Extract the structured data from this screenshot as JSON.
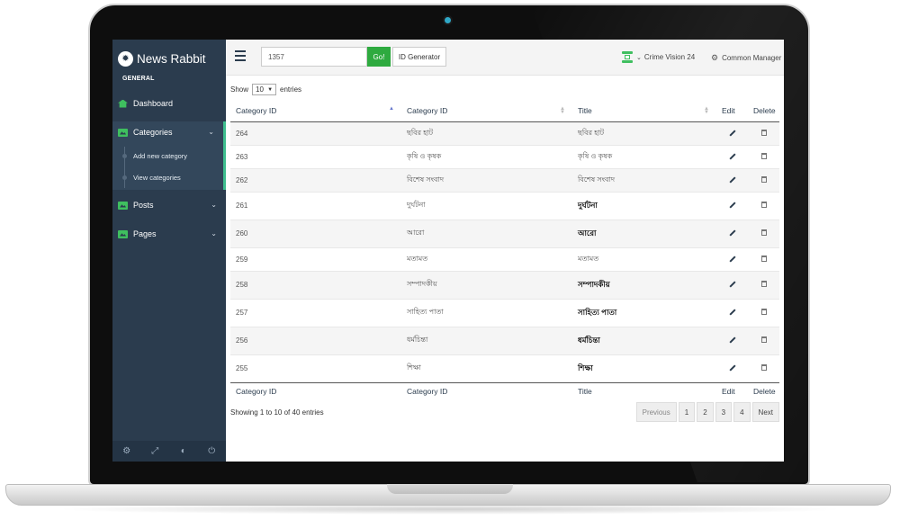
{
  "app": {
    "name": "News Rabbit"
  },
  "sidebar": {
    "section_label": "GENERAL",
    "dashboard": "Dashboard",
    "categories": "Categories",
    "sub_items": [
      "Add new category",
      "View categories"
    ],
    "posts": "Posts",
    "pages": "Pages",
    "footer_icons": [
      "gear-icon",
      "fullscreen-icon",
      "eye-slash-icon",
      "power-icon"
    ]
  },
  "topbar": {
    "search_value": "1357",
    "go_label": "Go!",
    "id_generator_label": "ID Generator",
    "site_name": "Crime Vision 24",
    "user_name": "Common Manager"
  },
  "table": {
    "length_show": "Show",
    "length_value": "10",
    "length_entries": "entries",
    "columns": [
      "Category ID",
      "Category ID",
      "Title",
      "Edit",
      "Delete"
    ],
    "rows": [
      {
        "id": "264",
        "cat": "ছবির হাট",
        "title": "ছবির হাট",
        "strong": false
      },
      {
        "id": "263",
        "cat": "কৃষি ও কৃষক",
        "title": "কৃষি ও কৃষক",
        "strong": false
      },
      {
        "id": "262",
        "cat": "বিশেষ সংবাদ",
        "title": "বিশেষ সংবাদ",
        "strong": false
      },
      {
        "id": "261",
        "cat": "দুর্ঘটনা",
        "title": "দুর্ঘটনা",
        "strong": true
      },
      {
        "id": "260",
        "cat": "আরো",
        "title": "আরো",
        "strong": true
      },
      {
        "id": "259",
        "cat": "মতামত",
        "title": "মতামত",
        "strong": false
      },
      {
        "id": "258",
        "cat": "সম্পাদকীয়",
        "title": "সম্পাদকীয়",
        "strong": true
      },
      {
        "id": "257",
        "cat": "সাহিত্য পাতা",
        "title": "সাহিত্য পাতা",
        "strong": true
      },
      {
        "id": "256",
        "cat": "ধর্মচিন্তা",
        "title": "ধর্মচিন্তা",
        "strong": true
      },
      {
        "id": "255",
        "cat": "শিক্ষা",
        "title": "শিক্ষা",
        "strong": true
      }
    ],
    "info": "Showing 1 to 10 of 40 entries",
    "pagination": [
      "Previous",
      "1",
      "2",
      "3",
      "4",
      "Next"
    ]
  },
  "colors": {
    "accent": "#2eaa3f",
    "sidebar": "#2b3c4e",
    "active_border": "#3fbf8f"
  }
}
